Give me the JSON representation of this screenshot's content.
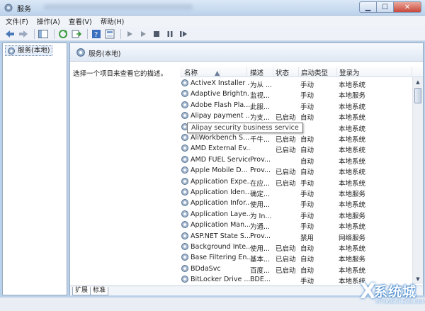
{
  "window": {
    "title": "服务",
    "minimize": "▁",
    "maximize": "☐",
    "close": "✕"
  },
  "menu": [
    "文件(F)",
    "操作(A)",
    "查看(V)",
    "帮助(H)"
  ],
  "tree": {
    "root": "服务(本地)"
  },
  "panel": {
    "title": "服务(本地)",
    "description": "选择一个项目来查看它的描述。",
    "columns": [
      "名称",
      "描述",
      "状态",
      "启动类型",
      "登录为"
    ]
  },
  "services": [
    {
      "name": "ActiveX Installer ...",
      "desc": "为从 ...",
      "status": "",
      "startup": "手动",
      "logon": "本地系统"
    },
    {
      "name": "Adaptive Brightn...",
      "desc": "监视...",
      "status": "",
      "startup": "手动",
      "logon": "本地服务"
    },
    {
      "name": "Adobe Flash Pla...",
      "desc": "此服...",
      "status": "",
      "startup": "手动",
      "logon": "本地系统"
    },
    {
      "name": "Alipay payment ...",
      "desc": "为支...",
      "status": "已启动",
      "startup": "自动",
      "logon": "本地系统"
    },
    {
      "name": "Alipay security ...",
      "desc": "",
      "status": "",
      "startup": "",
      "logon": "本地系统"
    },
    {
      "name": "AliWorkbench S...",
      "desc": "千牛...",
      "status": "已启动",
      "startup": "自动",
      "logon": "本地系统"
    },
    {
      "name": "AMD External Ev...",
      "desc": "",
      "status": "已启动",
      "startup": "自动",
      "logon": "本地系统"
    },
    {
      "name": "AMD FUEL Service",
      "desc": "Prov...",
      "status": "",
      "startup": "自动",
      "logon": "本地系统"
    },
    {
      "name": "Apple Mobile D...",
      "desc": "Prov...",
      "status": "已启动",
      "startup": "自动",
      "logon": "本地系统"
    },
    {
      "name": "Application Expe...",
      "desc": "在应...",
      "status": "已启动",
      "startup": "手动",
      "logon": "本地系统"
    },
    {
      "name": "Application Iden...",
      "desc": "确定...",
      "status": "",
      "startup": "手动",
      "logon": "本地服务"
    },
    {
      "name": "Application Infor...",
      "desc": "使用...",
      "status": "",
      "startup": "手动",
      "logon": "本地系统"
    },
    {
      "name": "Application Laye...",
      "desc": "为 In...",
      "status": "",
      "startup": "手动",
      "logon": "本地服务"
    },
    {
      "name": "Application Man...",
      "desc": "为通...",
      "status": "",
      "startup": "手动",
      "logon": "本地系统"
    },
    {
      "name": "ASP.NET State S...",
      "desc": "Prov...",
      "status": "",
      "startup": "禁用",
      "logon": "网络服务"
    },
    {
      "name": "Background Inte...",
      "desc": "使用...",
      "status": "已启动",
      "startup": "自动",
      "logon": "本地系统"
    },
    {
      "name": "Base Filtering En...",
      "desc": "基本...",
      "status": "已启动",
      "startup": "自动",
      "logon": "本地服务"
    },
    {
      "name": "BDdaSvc",
      "desc": "百度...",
      "status": "已启动",
      "startup": "自动",
      "logon": "本地系统"
    },
    {
      "name": "BitLocker Drive ...",
      "desc": "BDE...",
      "status": "",
      "startup": "手动",
      "logon": "本地系统"
    }
  ],
  "tooltip": "Alipay security business service",
  "tabs": [
    "扩展",
    "标准"
  ],
  "watermark": {
    "cn": "系统城",
    "url": "XITONGCHENG.COM",
    "mark": "X"
  }
}
